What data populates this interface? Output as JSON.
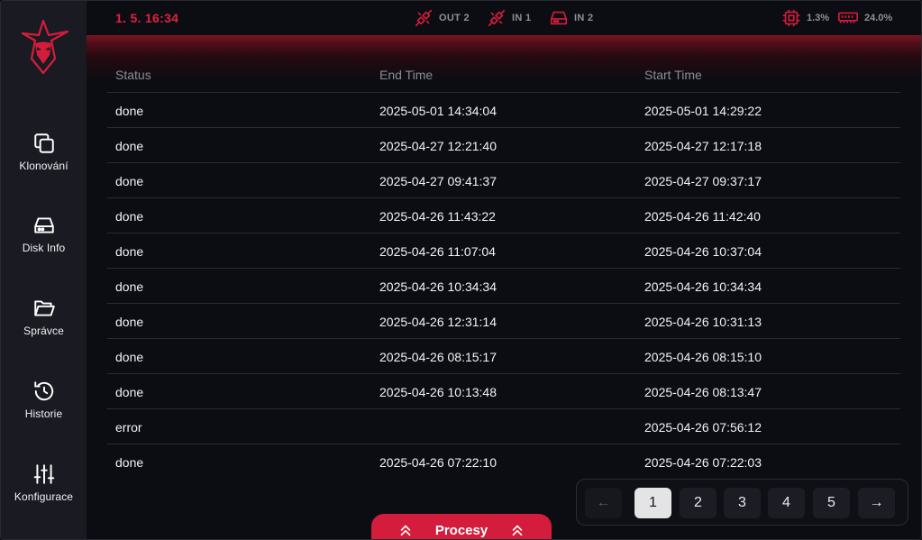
{
  "topbar": {
    "clock": "1. 5. 16:34",
    "ports": [
      {
        "label": "OUT 2",
        "icon": "plug-disconnected-icon"
      },
      {
        "label": "IN 1",
        "icon": "plug-disconnected-icon"
      },
      {
        "label": "IN 2",
        "icon": "hard-drive-icon"
      }
    ],
    "cpu": "1.3%",
    "ram": "24.0%"
  },
  "sidebar": {
    "items": [
      {
        "label": "Klonování",
        "icon": "copy-icon"
      },
      {
        "label": "Disk Info",
        "icon": "hard-drive-icon"
      },
      {
        "label": "Správce",
        "icon": "folder-open-icon"
      },
      {
        "label": "Historie",
        "icon": "history-icon"
      },
      {
        "label": "Konfigurace",
        "icon": "sliders-icon"
      }
    ]
  },
  "table": {
    "headers": [
      "Status",
      "End Time",
      "Start Time"
    ],
    "rows": [
      [
        "done",
        "2025-05-01 14:34:04",
        "2025-05-01 14:29:22"
      ],
      [
        "done",
        "2025-04-27 12:21:40",
        "2025-04-27 12:17:18"
      ],
      [
        "done",
        "2025-04-27 09:41:37",
        "2025-04-27 09:37:17"
      ],
      [
        "done",
        "2025-04-26 11:43:22",
        "2025-04-26 11:42:40"
      ],
      [
        "done",
        "2025-04-26 11:07:04",
        "2025-04-26 10:37:04"
      ],
      [
        "done",
        "2025-04-26 10:34:34",
        "2025-04-26 10:34:34"
      ],
      [
        "done",
        "2025-04-26 12:31:14",
        "2025-04-26 10:31:13"
      ],
      [
        "done",
        "2025-04-26 08:15:17",
        "2025-04-26 08:15:10"
      ],
      [
        "done",
        "2025-04-26 10:13:48",
        "2025-04-26 08:13:47"
      ],
      [
        "error",
        "",
        "2025-04-26 07:56:12"
      ],
      [
        "done",
        "2025-04-26 07:22:10",
        "2025-04-26 07:22:03"
      ]
    ]
  },
  "pagination": {
    "prev": "←",
    "pages": [
      "1",
      "2",
      "3",
      "4",
      "5"
    ],
    "current": "1",
    "next": "→"
  },
  "procesy": {
    "label": "Procesy"
  },
  "colors": {
    "accent": "#d41c3c",
    "background": "#0c0d12",
    "sidebar": "#1a1b22"
  }
}
